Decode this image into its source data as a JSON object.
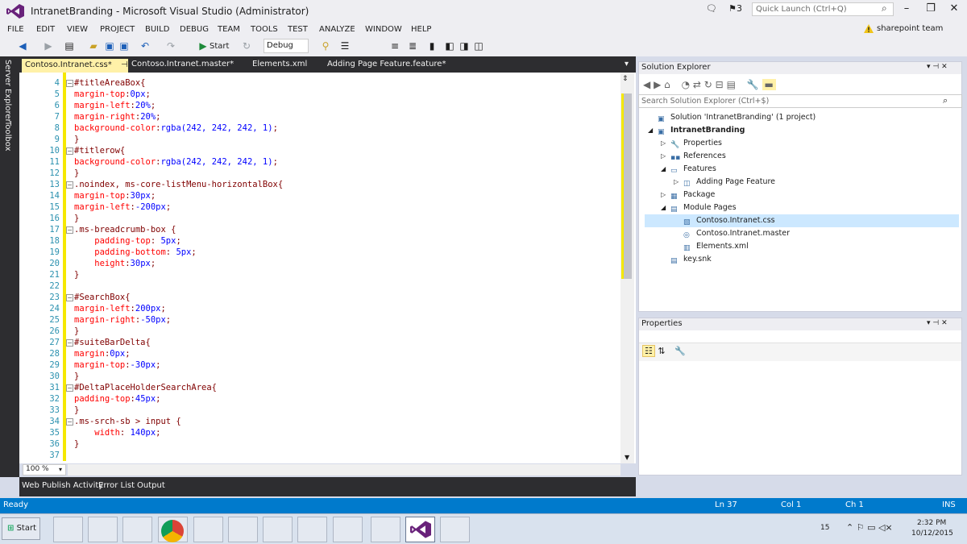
{
  "window": {
    "title": "IntranetBranding - Microsoft Visual Studio (Administrator)",
    "notification_count": "3",
    "quick_launch_placeholder": "Quick Launch (Ctrl+Q)"
  },
  "menu": [
    "FILE",
    "EDIT",
    "VIEW",
    "PROJECT",
    "BUILD",
    "DEBUG",
    "TEAM",
    "TOOLS",
    "TEST",
    "ANALYZE",
    "WINDOW",
    "HELP"
  ],
  "team": "sharepoint team",
  "toolbar": {
    "start_label": "Start",
    "config_value": "Debug"
  },
  "side_tabs": [
    "Server Explorer",
    "Toolbox"
  ],
  "doc_tabs": [
    "Contoso.Intranet.css*",
    "Contoso.Intranet.master*",
    "Elements.xml",
    "Adding Page Feature.feature*"
  ],
  "editor": {
    "lines": [
      {
        "n": "4",
        "parts": [
          {
            "t": "#titleAreaBox{",
            "c": "sel"
          }
        ]
      },
      {
        "n": "5",
        "parts": [
          {
            "t": "margin-top",
            "c": "prop"
          },
          {
            "t": ":",
            "c": "sel"
          },
          {
            "t": "0px",
            "c": "val"
          },
          {
            "t": ";",
            "c": "sel"
          }
        ]
      },
      {
        "n": "6",
        "parts": [
          {
            "t": "margin-left",
            "c": "prop"
          },
          {
            "t": ":",
            "c": "sel"
          },
          {
            "t": "20%",
            "c": "val"
          },
          {
            "t": ";",
            "c": "sel"
          }
        ]
      },
      {
        "n": "7",
        "parts": [
          {
            "t": "margin-right",
            "c": "prop"
          },
          {
            "t": ":",
            "c": "sel"
          },
          {
            "t": "20%",
            "c": "val"
          },
          {
            "t": ";",
            "c": "sel"
          }
        ]
      },
      {
        "n": "8",
        "parts": [
          {
            "t": "background-color",
            "c": "prop"
          },
          {
            "t": ":",
            "c": "sel"
          },
          {
            "t": "rgba(242, 242, 242, 1)",
            "c": "val"
          },
          {
            "t": ";",
            "c": "sel"
          }
        ]
      },
      {
        "n": "9",
        "parts": [
          {
            "t": "}",
            "c": "sel"
          }
        ]
      },
      {
        "n": "10",
        "parts": [
          {
            "t": "#titlerow{",
            "c": "sel"
          }
        ]
      },
      {
        "n": "11",
        "parts": [
          {
            "t": "background-color",
            "c": "prop"
          },
          {
            "t": ":",
            "c": "sel"
          },
          {
            "t": "rgba(242, 242, 242, 1)",
            "c": "val"
          },
          {
            "t": ";",
            "c": "sel"
          }
        ]
      },
      {
        "n": "12",
        "parts": [
          {
            "t": "}",
            "c": "sel"
          }
        ]
      },
      {
        "n": "13",
        "parts": [
          {
            "t": ".noindex, ms-core-listMenu-horizontalBox{",
            "c": "sel"
          }
        ]
      },
      {
        "n": "14",
        "parts": [
          {
            "t": "margin-top",
            "c": "prop"
          },
          {
            "t": ":",
            "c": "sel"
          },
          {
            "t": "30px",
            "c": "val"
          },
          {
            "t": ";",
            "c": "sel"
          }
        ]
      },
      {
        "n": "15",
        "parts": [
          {
            "t": "margin-left",
            "c": "prop"
          },
          {
            "t": ":",
            "c": "sel"
          },
          {
            "t": "-200px",
            "c": "val"
          },
          {
            "t": ";",
            "c": "sel"
          }
        ]
      },
      {
        "n": "16",
        "parts": [
          {
            "t": "}",
            "c": "sel"
          }
        ]
      },
      {
        "n": "17",
        "parts": [
          {
            "t": ".ms-breadcrumb-box {",
            "c": "sel"
          }
        ]
      },
      {
        "n": "18",
        "parts": [
          {
            "t": "    padding-top",
            "c": "prop"
          },
          {
            "t": ": ",
            "c": "sel"
          },
          {
            "t": "5px",
            "c": "val"
          },
          {
            "t": ";",
            "c": "sel"
          }
        ]
      },
      {
        "n": "19",
        "parts": [
          {
            "t": "    padding-bottom",
            "c": "prop"
          },
          {
            "t": ": ",
            "c": "sel"
          },
          {
            "t": "5px",
            "c": "val"
          },
          {
            "t": ";",
            "c": "sel"
          }
        ]
      },
      {
        "n": "20",
        "parts": [
          {
            "t": "    height",
            "c": "prop"
          },
          {
            "t": ":",
            "c": "sel"
          },
          {
            "t": "30px",
            "c": "val"
          },
          {
            "t": ";",
            "c": "sel"
          }
        ]
      },
      {
        "n": "21",
        "parts": [
          {
            "t": "}",
            "c": "sel"
          }
        ]
      },
      {
        "n": "22",
        "parts": [
          {
            "t": "",
            "c": "sel"
          }
        ]
      },
      {
        "n": "23",
        "parts": [
          {
            "t": "#SearchBox{",
            "c": "sel"
          }
        ]
      },
      {
        "n": "24",
        "parts": [
          {
            "t": "margin-left",
            "c": "prop"
          },
          {
            "t": ":",
            "c": "sel"
          },
          {
            "t": "200px",
            "c": "val"
          },
          {
            "t": ";",
            "c": "sel"
          }
        ]
      },
      {
        "n": "25",
        "parts": [
          {
            "t": "margin-right",
            "c": "prop"
          },
          {
            "t": ":",
            "c": "sel"
          },
          {
            "t": "-50px",
            "c": "val"
          },
          {
            "t": ";",
            "c": "sel"
          }
        ]
      },
      {
        "n": "26",
        "parts": [
          {
            "t": "}",
            "c": "sel"
          }
        ]
      },
      {
        "n": "27",
        "parts": [
          {
            "t": "#suiteBarDelta{",
            "c": "sel"
          }
        ]
      },
      {
        "n": "28",
        "parts": [
          {
            "t": "margin",
            "c": "prop"
          },
          {
            "t": ":",
            "c": "sel"
          },
          {
            "t": "0px",
            "c": "val"
          },
          {
            "t": ";",
            "c": "sel"
          }
        ]
      },
      {
        "n": "29",
        "parts": [
          {
            "t": "margin-top",
            "c": "prop"
          },
          {
            "t": ":",
            "c": "sel"
          },
          {
            "t": "-30px",
            "c": "val"
          },
          {
            "t": ";",
            "c": "sel"
          }
        ]
      },
      {
        "n": "30",
        "parts": [
          {
            "t": "}",
            "c": "sel"
          }
        ]
      },
      {
        "n": "31",
        "parts": [
          {
            "t": "#DeltaPlaceHolderSearchArea{",
            "c": "sel"
          }
        ]
      },
      {
        "n": "32",
        "parts": [
          {
            "t": "padding-top",
            "c": "prop"
          },
          {
            "t": ":",
            "c": "sel"
          },
          {
            "t": "45px",
            "c": "val"
          },
          {
            "t": ";",
            "c": "sel"
          }
        ]
      },
      {
        "n": "33",
        "parts": [
          {
            "t": "}",
            "c": "sel"
          }
        ]
      },
      {
        "n": "34",
        "parts": [
          {
            "t": ".ms-srch-sb > input {",
            "c": "sel"
          }
        ]
      },
      {
        "n": "35",
        "parts": [
          {
            "t": "    width",
            "c": "prop"
          },
          {
            "t": ": ",
            "c": "sel"
          },
          {
            "t": "140px",
            "c": "val"
          },
          {
            "t": ";",
            "c": "sel"
          }
        ]
      },
      {
        "n": "36",
        "parts": [
          {
            "t": "}",
            "c": "sel"
          }
        ]
      },
      {
        "n": "37",
        "parts": [
          {
            "t": "",
            "c": "sel"
          }
        ]
      }
    ],
    "zoom": "100 %"
  },
  "bottom_tabs": [
    "Web Publish Activity",
    "Error List",
    "Output"
  ],
  "solution_explorer": {
    "title": "Solution Explorer",
    "search_placeholder": "Search Solution Explorer (Ctrl+$)",
    "items": [
      {
        "label": "Solution 'IntranetBranding' (1 project)",
        "indent": 0,
        "icon": "solution-icon",
        "expander": "",
        "bold": false,
        "selected": false
      },
      {
        "label": "IntranetBranding",
        "indent": 0,
        "icon": "project-icon",
        "expander": "◢",
        "bold": true,
        "selected": false
      },
      {
        "label": "Properties",
        "indent": 1,
        "icon": "wrench-icon",
        "expander": "▷",
        "bold": false,
        "selected": false
      },
      {
        "label": "References",
        "indent": 1,
        "icon": "references-icon",
        "expander": "▷",
        "bold": false,
        "selected": false
      },
      {
        "label": "Features",
        "indent": 1,
        "icon": "folder-icon",
        "expander": "◢",
        "bold": false,
        "selected": false
      },
      {
        "label": "Adding Page Feature",
        "indent": 2,
        "icon": "feature-icon",
        "expander": "▷",
        "bold": false,
        "selected": false
      },
      {
        "label": "Package",
        "indent": 1,
        "icon": "package-icon",
        "expander": "▷",
        "bold": false,
        "selected": false
      },
      {
        "label": "Module Pages",
        "indent": 1,
        "icon": "module-icon",
        "expander": "◢",
        "bold": false,
        "selected": false
      },
      {
        "label": "Contoso.Intranet.css",
        "indent": 2,
        "icon": "css-file-icon",
        "expander": "",
        "bold": false,
        "selected": true
      },
      {
        "label": "Contoso.Intranet.master",
        "indent": 2,
        "icon": "master-file-icon",
        "expander": "",
        "bold": false,
        "selected": false
      },
      {
        "label": "Elements.xml",
        "indent": 2,
        "icon": "xml-file-icon",
        "expander": "",
        "bold": false,
        "selected": false
      },
      {
        "label": "key.snk",
        "indent": 1,
        "icon": "key-file-icon",
        "expander": "",
        "bold": false,
        "selected": false
      }
    ]
  },
  "properties": {
    "title": "Properties"
  },
  "status": {
    "ready": "Ready",
    "ln": "Ln 37",
    "col": "Col 1",
    "ch": "Ch 1",
    "ins": "INS"
  },
  "taskbar": {
    "start": "Start",
    "tray_count": "15",
    "time": "2:32 PM",
    "date": "10/12/2015"
  },
  "colors": {
    "accent": "#007acc",
    "active_tab": "#fff1a8",
    "change_bar": "#f5e800",
    "selector": "#800000",
    "property": "#ff0000",
    "value": "#0000ff"
  }
}
